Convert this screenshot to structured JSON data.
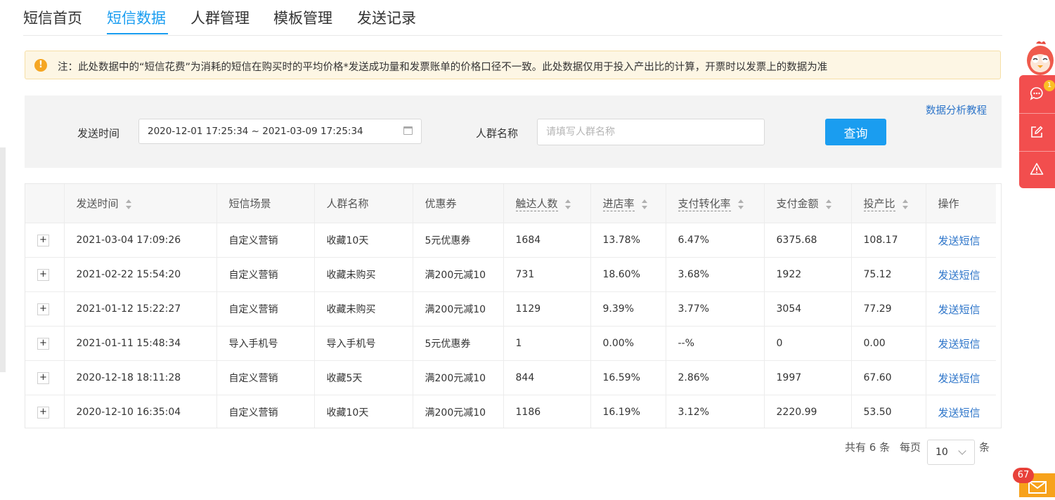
{
  "tabs": [
    {
      "label": "短信首页",
      "active": false
    },
    {
      "label": "短信数据",
      "active": true
    },
    {
      "label": "人群管理",
      "active": false
    },
    {
      "label": "模板管理",
      "active": false
    },
    {
      "label": "发送记录",
      "active": false
    }
  ],
  "notice": {
    "icon": "exclamation-icon",
    "text": "注：此处数据中的“短信花费”为消耗的短信在购买时的平均价格*发送成功量和发票账单的价格口径不一致。此处数据仅用于投入产出比的计算，开票时以发票上的数据为准"
  },
  "filter": {
    "send_time_label": "发送时间",
    "date_range_value": "2020-12-01 17:25:34 ~ 2021-03-09 17:25:34",
    "crowd_name_label": "人群名称",
    "crowd_name_placeholder": "请填写人群名称",
    "crowd_name_value": "",
    "query_button": "查询",
    "tutorial_link": "数据分析教程"
  },
  "table": {
    "columns": [
      "",
      "发送时间",
      "短信场景",
      "人群名称",
      "优惠券",
      "触达人数",
      "进店率",
      "支付转化率",
      "支付金额",
      "投产比",
      "操作"
    ],
    "expand_symbol": "+",
    "rows": [
      {
        "time": "2021-03-04 17:09:26",
        "scene": "自定义营销",
        "crowd": "收藏10天",
        "coupon": "5元优惠券",
        "reach": "1684",
        "visit_rate": "13.78%",
        "pay_rate": "6.47%",
        "amount": "6375.68",
        "roi": "108.17",
        "action": "发送短信"
      },
      {
        "time": "2021-02-22 15:54:20",
        "scene": "自定义营销",
        "crowd": "收藏未购买",
        "coupon": "满200元减10",
        "reach": "731",
        "visit_rate": "18.60%",
        "pay_rate": "3.68%",
        "amount": "1922",
        "roi": "75.12",
        "action": "发送短信"
      },
      {
        "time": "2021-01-12 15:22:27",
        "scene": "自定义营销",
        "crowd": "收藏未购买",
        "coupon": "满200元减10",
        "reach": "1129",
        "visit_rate": "9.39%",
        "pay_rate": "3.77%",
        "amount": "3054",
        "roi": "77.29",
        "action": "发送短信"
      },
      {
        "time": "2021-01-11 15:48:34",
        "scene": "导入手机号",
        "crowd": "导入手机号",
        "coupon": "5元优惠券",
        "reach": "1",
        "visit_rate": "0.00%",
        "pay_rate": "--%",
        "amount": "0",
        "roi": "0.00",
        "action": "发送短信"
      },
      {
        "time": "2020-12-18 18:11:28",
        "scene": "自定义营销",
        "crowd": "收藏5天",
        "coupon": "满200元减10",
        "reach": "844",
        "visit_rate": "16.59%",
        "pay_rate": "2.86%",
        "amount": "1997",
        "roi": "67.60",
        "action": "发送短信"
      },
      {
        "time": "2020-12-10 16:35:04",
        "scene": "自定义营销",
        "crowd": "收藏10天",
        "coupon": "满200元减10",
        "reach": "1186",
        "visit_rate": "16.19%",
        "pay_rate": "3.12%",
        "amount": "2220.99",
        "roi": "53.50",
        "action": "发送短信"
      }
    ]
  },
  "pagination": {
    "total_prefix": "共有",
    "total": "6",
    "total_suffix": "条",
    "per_page_label": "每页",
    "page_size": "10",
    "page_size_suffix": "条"
  },
  "side_tools": {
    "chat_badge": "1",
    "mail_badge": "67",
    "icons": [
      "chat-icon",
      "edit-icon",
      "warning-icon",
      "mail-icon"
    ]
  },
  "colors": {
    "accent": "#1a9df0",
    "link": "#2c74c9",
    "notice_bg": "#fdf6e4",
    "warning": "#f5a623",
    "side_tools": "#f24e4e",
    "mail": "#f7a21b"
  }
}
